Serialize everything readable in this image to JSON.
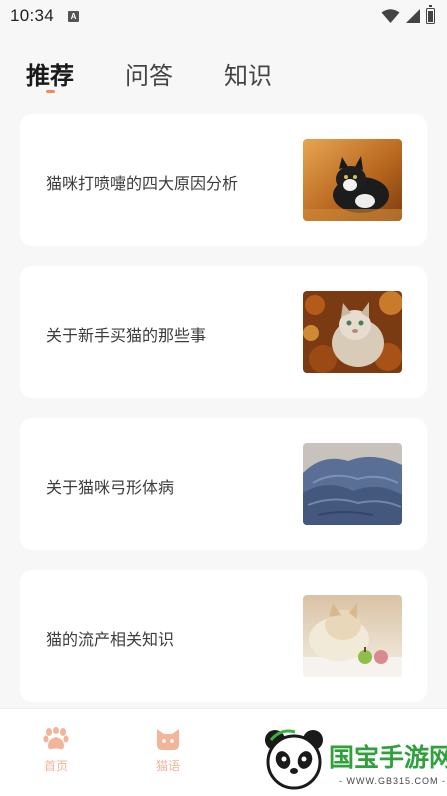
{
  "status_bar": {
    "time": "10:34",
    "notification_icon": "a-square-icon",
    "icons": [
      "wifi-icon",
      "signal-icon",
      "battery-icon"
    ]
  },
  "tabs": [
    {
      "label": "推荐",
      "active": true
    },
    {
      "label": "问答",
      "active": false
    },
    {
      "label": "知识",
      "active": false
    }
  ],
  "accent_color": "#f08a5d",
  "articles": [
    {
      "title": "猫咪打喷嚏的四大原因分析",
      "thumbnail": "black-white-cat-photo"
    },
    {
      "title": "关于新手买猫的那些事",
      "thumbnail": "fluffy-cat-autumn-photo"
    },
    {
      "title": "关于猫咪弓形体病",
      "thumbnail": "blue-knit-blanket-photo"
    },
    {
      "title": "猫的流产相关知识",
      "thumbnail": "cat-with-apples-photo"
    }
  ],
  "bottom_nav": [
    {
      "label": "首页",
      "icon": "paw-icon"
    },
    {
      "label": "猫语",
      "icon": "cat-face-icon"
    }
  ],
  "watermark": {
    "text": "国宝手游网",
    "url": "- WWW.GB315.COM -",
    "icon": "panda-logo-icon"
  }
}
